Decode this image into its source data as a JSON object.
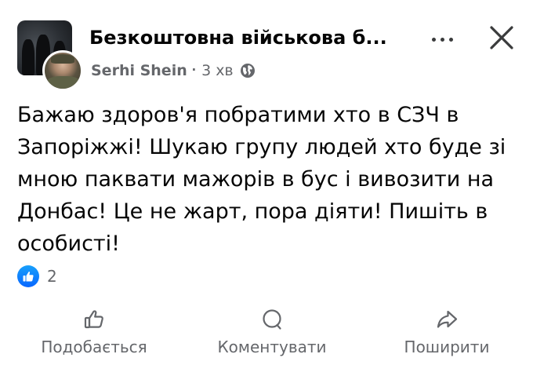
{
  "post": {
    "group_name": "Безкоштовна військова б...",
    "author": "Serhi Shein",
    "separator": "·",
    "time": "3 хв",
    "message": "Бажаю здоров'я побратими хто в СЗЧ в\nЗапоріжжі! Шукаю групу людей хто буде зі\nмною паквати мажорів в бус і вивозити на\nДонбас! Це не жарт, пора діяти! Пишіть в\nособисті!",
    "reactions": {
      "icon": "like-icon",
      "count": "2"
    }
  },
  "actions": {
    "like_label": "Подобається",
    "comment_label": "Коментувати",
    "share_label": "Поширити"
  },
  "colors": {
    "accent": "#0866ff",
    "text": "#050505",
    "secondary_text": "#65676b"
  }
}
